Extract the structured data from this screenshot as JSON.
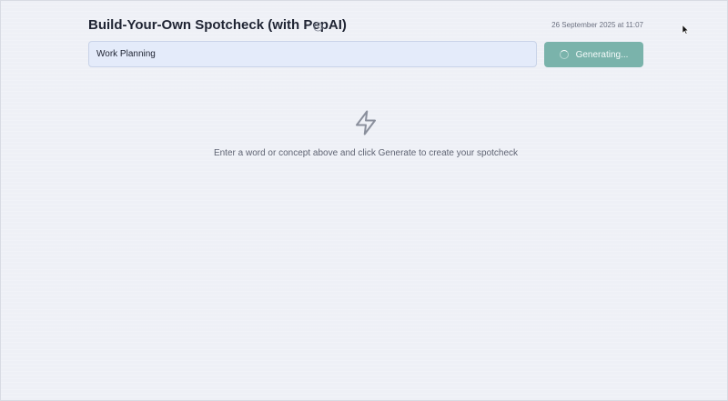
{
  "header": {
    "title": "Build-Your-Own Spotcheck (with PepAI)",
    "timestamp": "26 September 2025 at 11:07",
    "info_icon": "info-circle-icon"
  },
  "input": {
    "value": "Work Planning"
  },
  "generate_button": {
    "label": "Generating...",
    "icon": "spinner-icon",
    "color": "#7ab3ab"
  },
  "empty_state": {
    "icon": "lightning-bolt-icon",
    "message": "Enter a word or concept above and click Generate to create your spotcheck"
  },
  "colors": {
    "background": "#eef0f6",
    "input_background": "#e4ebfa",
    "title_text": "#1f2433"
  }
}
